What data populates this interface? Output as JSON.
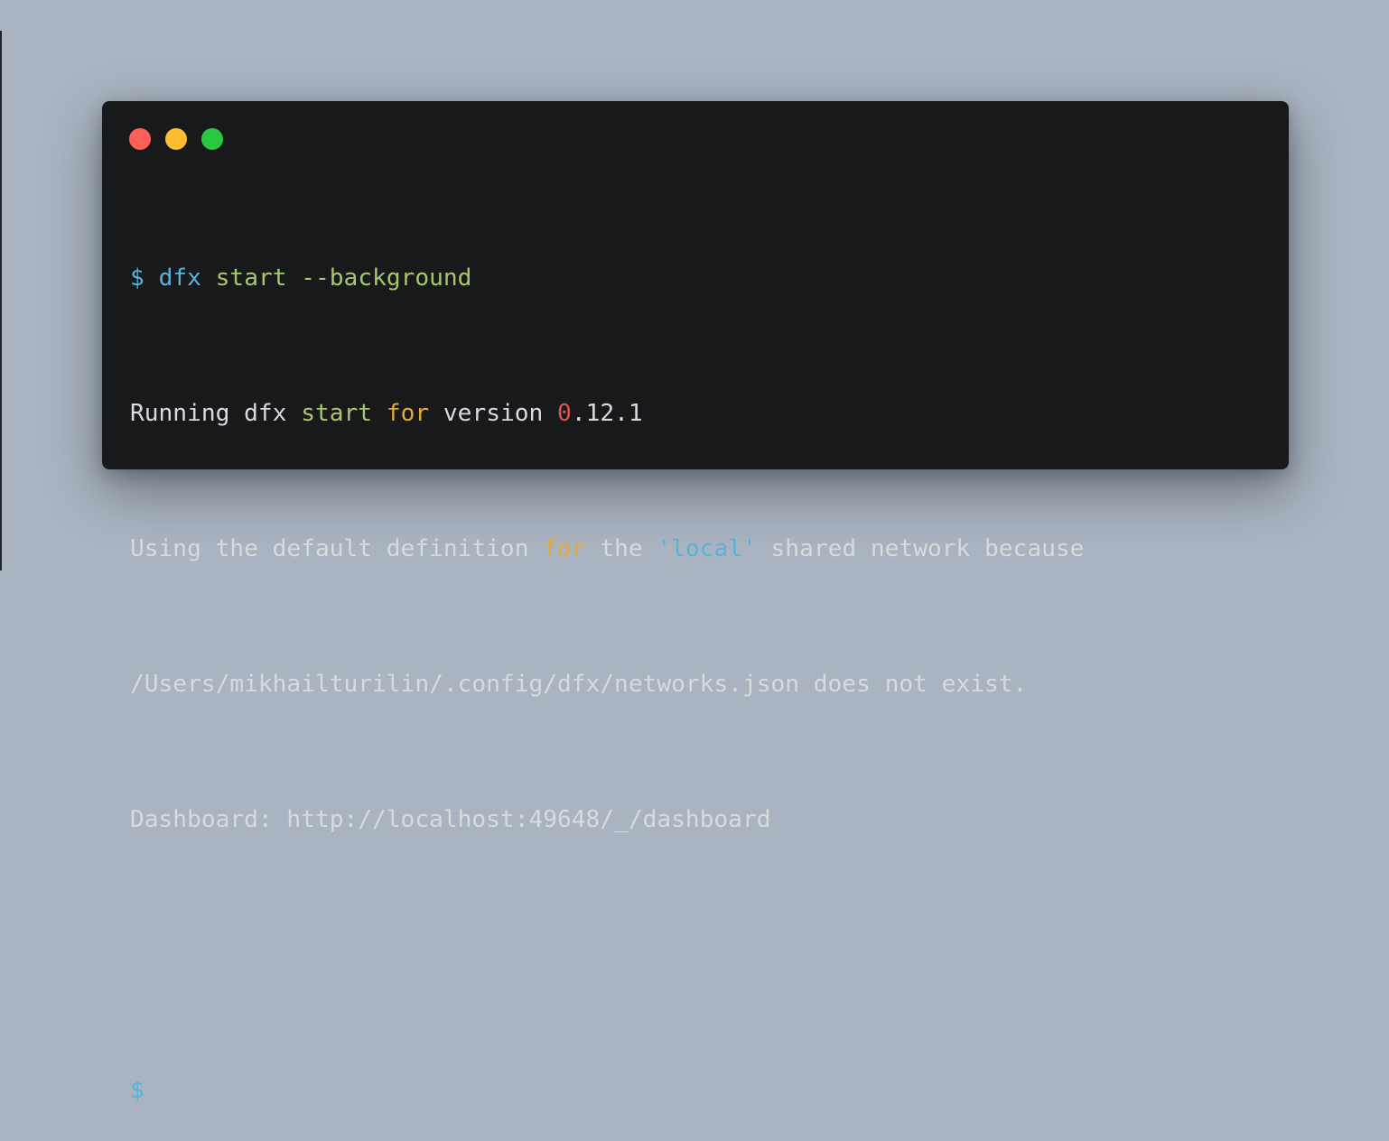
{
  "window": {
    "controls": [
      {
        "name": "close",
        "color": "#ff5f57"
      },
      {
        "name": "minimize",
        "color": "#febc2e"
      },
      {
        "name": "maximize",
        "color": "#28c840"
      }
    ]
  },
  "terminal": {
    "line1": {
      "prompt": "$",
      "command": "dfx",
      "args": "start --background"
    },
    "line2": {
      "part1": "Running dfx ",
      "kw_start": "start",
      "part2": " ",
      "kw_for": "for",
      "part3": " version ",
      "num_zero": "0",
      "part4": ".12.1"
    },
    "line3": {
      "part1": "Using the default definition ",
      "kw_for": "for",
      "part2": " the ",
      "string_local": "'local'",
      "part3": " shared network because"
    },
    "line4": {
      "text": "/Users/mikhailturilin/.config/dfx/networks.json does not exist."
    },
    "line5": {
      "text": "Dashboard: http://localhost:49648/_/dashboard"
    },
    "line6": {
      "prompt": "$"
    }
  }
}
